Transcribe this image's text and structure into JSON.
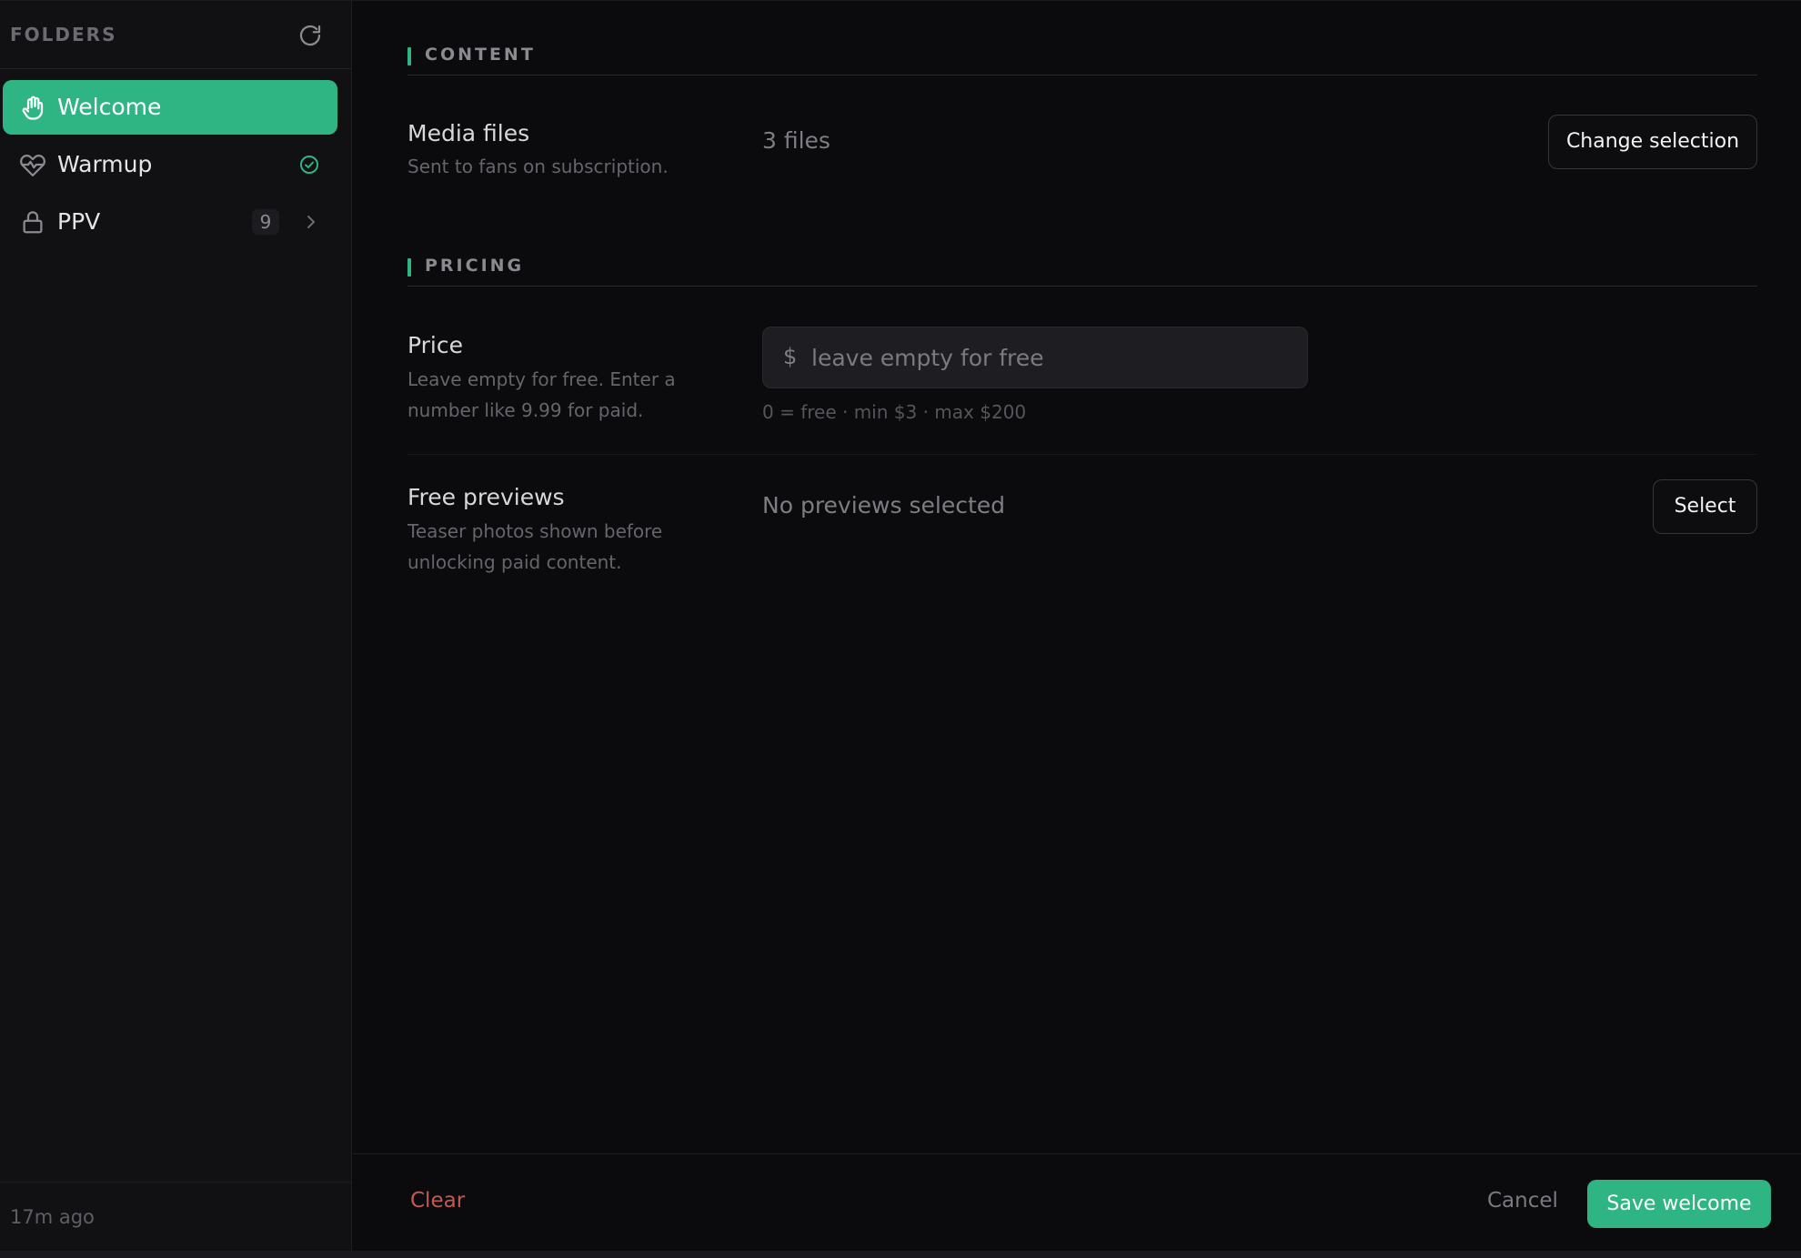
{
  "colors": {
    "accent": "#2fb583",
    "danger": "#c25a55",
    "background": "#0b0b0d",
    "sidebar_background": "#111114"
  },
  "sidebar": {
    "title": "FOLDERS",
    "refresh_icon": "refresh-icon",
    "items": [
      {
        "label": "Welcome",
        "icon": "hand-icon",
        "active": true
      },
      {
        "label": "Warmup",
        "icon": "heart-pulse-icon",
        "status_icon": "check-circle-icon"
      },
      {
        "label": "PPV",
        "icon": "lock-icon",
        "count": "9",
        "chevron_icon": "chevron-right-icon"
      }
    ],
    "footer_text": "17m ago"
  },
  "main": {
    "content_section": {
      "title": "CONTENT",
      "media": {
        "label": "Media files",
        "description": "Sent to fans on subscription.",
        "value": "3 files",
        "button": "Change selection"
      }
    },
    "pricing_section": {
      "title": "PRICING",
      "price": {
        "label": "Price",
        "description": "Leave empty for free. Enter a number like 9.99 for paid.",
        "currency": "$",
        "value": "",
        "placeholder": "leave empty for free",
        "hint": "0 = free · min $3 · max $200"
      },
      "previews": {
        "label": "Free previews",
        "description": "Teaser photos shown before unlocking paid content.",
        "value": "No previews selected",
        "button": "Select"
      }
    }
  },
  "footer": {
    "clear": "Clear",
    "cancel": "Cancel",
    "save": "Save welcome"
  }
}
